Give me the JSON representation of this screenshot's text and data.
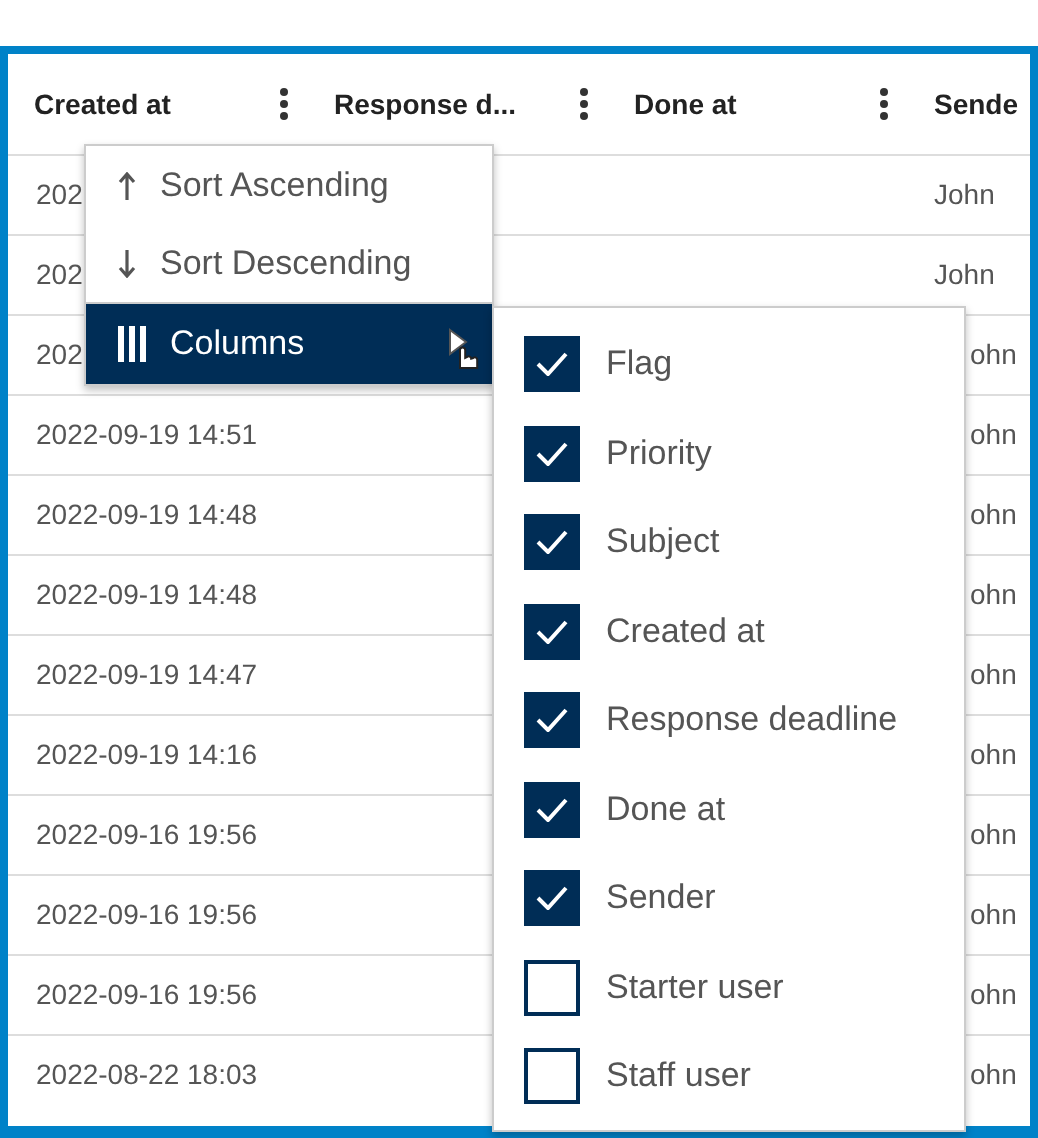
{
  "table": {
    "columns": [
      {
        "label": "Created at"
      },
      {
        "label": "Response d..."
      },
      {
        "label": "Done at"
      },
      {
        "label": "Sende"
      }
    ],
    "rows": [
      {
        "created_at": "202",
        "sender": "John"
      },
      {
        "created_at": "202",
        "sender": "John"
      },
      {
        "created_at": "202",
        "sender": "ohn"
      },
      {
        "created_at": "2022-09-19 14:51",
        "sender": "ohn"
      },
      {
        "created_at": "2022-09-19 14:48",
        "sender": "ohn"
      },
      {
        "created_at": "2022-09-19 14:48",
        "sender": "ohn"
      },
      {
        "created_at": "2022-09-19 14:47",
        "sender": "ohn"
      },
      {
        "created_at": "2022-09-19 14:16",
        "sender": "ohn"
      },
      {
        "created_at": "2022-09-16 19:56",
        "sender": "ohn"
      },
      {
        "created_at": "2022-09-16 19:56",
        "sender": "ohn"
      },
      {
        "created_at": "2022-09-16 19:56",
        "sender": "ohn"
      },
      {
        "created_at": "2022-08-22 18:03",
        "sender": "ohn"
      }
    ]
  },
  "column_menu": {
    "items": [
      {
        "kind": "sort-up",
        "label": "Sort Ascending",
        "selected": false
      },
      {
        "kind": "sort-down",
        "label": "Sort Descending",
        "selected": false
      },
      {
        "kind": "columns",
        "label": "Columns",
        "selected": true
      }
    ]
  },
  "columns_submenu": {
    "items": [
      {
        "label": "Flag",
        "checked": true
      },
      {
        "label": "Priority",
        "checked": true
      },
      {
        "label": "Subject",
        "checked": true
      },
      {
        "label": "Created at",
        "checked": true
      },
      {
        "label": "Response deadline",
        "checked": true
      },
      {
        "label": "Done at",
        "checked": true
      },
      {
        "label": "Sender",
        "checked": true
      },
      {
        "label": "Starter user",
        "checked": false
      },
      {
        "label": "Staff user",
        "checked": false
      }
    ]
  }
}
